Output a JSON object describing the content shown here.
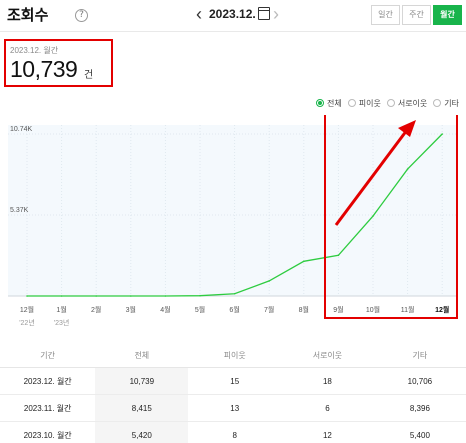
{
  "header": {
    "title": "조회수",
    "help_icon_glyph": "?",
    "current_month": "2023.12.",
    "periods": [
      "일간",
      "주간",
      "월간"
    ],
    "active_period": "월간"
  },
  "summary": {
    "label": "2023.12. 월간",
    "value": "10,739",
    "unit": "건"
  },
  "legend": {
    "items": [
      "전체",
      "피이웃",
      "서로이웃",
      "기타"
    ],
    "selected": "전체"
  },
  "chart_data": {
    "type": "line",
    "x": [
      "12월",
      "1월",
      "2월",
      "3월",
      "4월",
      "5월",
      "6월",
      "7월",
      "8월",
      "9월",
      "10월",
      "11월",
      "12월"
    ],
    "year_labels": [
      {
        "index": 0,
        "text": "'22년"
      },
      {
        "index": 1,
        "text": "'23년"
      }
    ],
    "y_tick_labels": [
      {
        "value": 5370,
        "text": "5.37K"
      },
      {
        "value": 10740,
        "text": "10.74K"
      }
    ],
    "ylim": [
      0,
      10740
    ],
    "series": [
      {
        "values": [
          0,
          0,
          0,
          0,
          0,
          20,
          150,
          1000,
          2300,
          2700,
          5300,
          8415,
          10739
        ],
        "color": "#2ecc40"
      }
    ],
    "highlighted_x_index": 12,
    "annotation": {
      "box_color": "#e30000",
      "arrow_color": "#e30000"
    },
    "grid": true,
    "plot_bg": "#f4f9fd"
  },
  "table": {
    "headers": [
      "기간",
      "전체",
      "피이웃",
      "서로이웃",
      "기타"
    ],
    "rows": [
      [
        "2023.12. 월간",
        "10,739",
        "15",
        "18",
        "10,706"
      ],
      [
        "2023.11. 월간",
        "8,415",
        "13",
        "6",
        "8,396"
      ],
      [
        "2023.10. 월간",
        "5,420",
        "8",
        "12",
        "5,400"
      ]
    ]
  }
}
